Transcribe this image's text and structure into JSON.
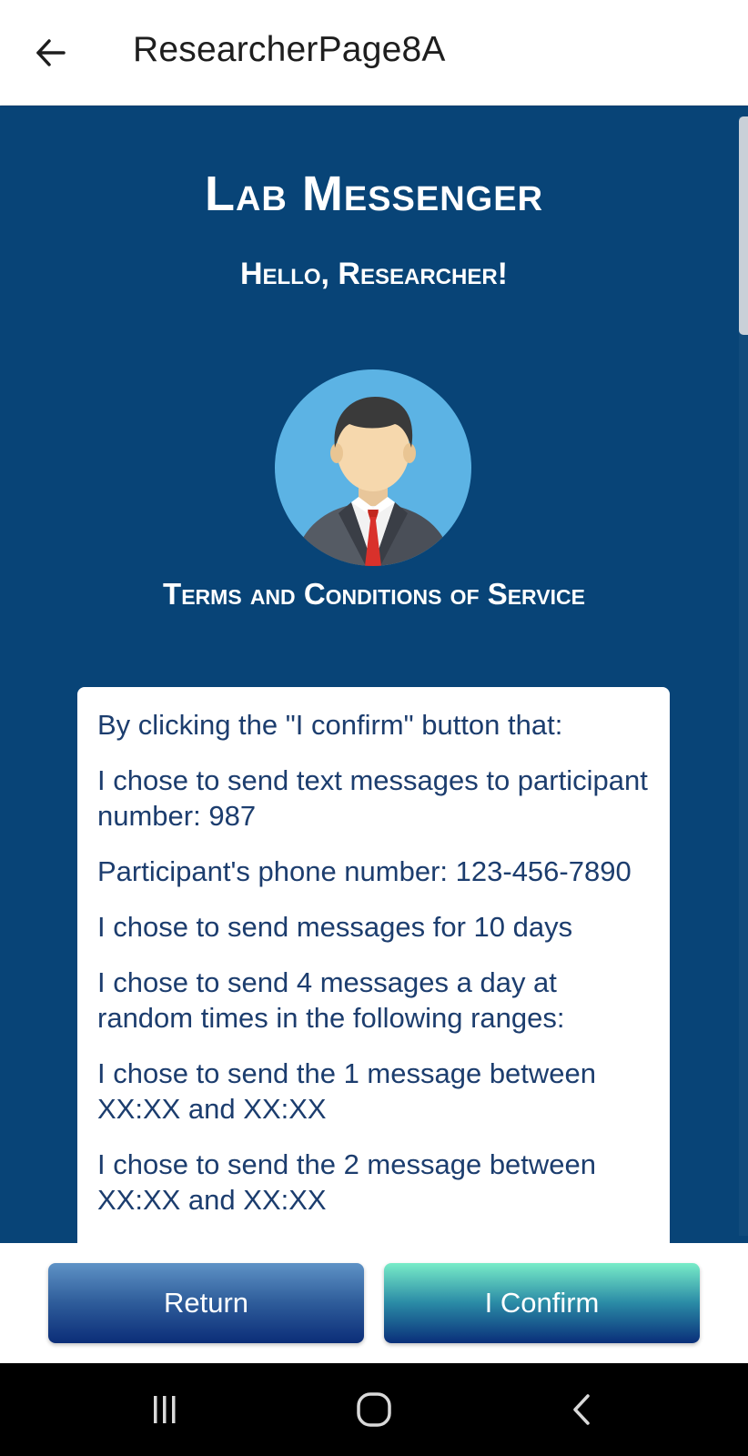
{
  "appbar": {
    "title": "ResearcherPage8A",
    "back_icon": "arrow-left-icon"
  },
  "header": {
    "app_title": "Lab Messenger",
    "greeting": "Hello, Researcher!"
  },
  "avatar": {
    "icon": "businessman-avatar-icon"
  },
  "terms": {
    "heading": "Terms and Conditions of Service",
    "paragraphs": [
      "By clicking the \"I confirm\" button that:",
      "I chose to send text messages to participant number: 987",
      "Participant's phone number: 123-456-7890",
      "I chose to send messages for 10 days",
      "I chose to send 4 messages a day at random times in the following ranges:",
      "I chose to send the 1 message between XX:XX and XX:XX",
      "I chose to send the 2 message between XX:XX and XX:XX"
    ]
  },
  "buttons": {
    "return_label": "Return",
    "confirm_label": "I Confirm"
  },
  "navbar": {
    "recents_icon": "recent-apps-icon",
    "home_icon": "home-icon",
    "back_icon": "back-chevron-icon"
  },
  "colors": {
    "page_background": "#084477",
    "text_dark_blue": "#1c3d6e",
    "card_background": "#ffffff"
  }
}
